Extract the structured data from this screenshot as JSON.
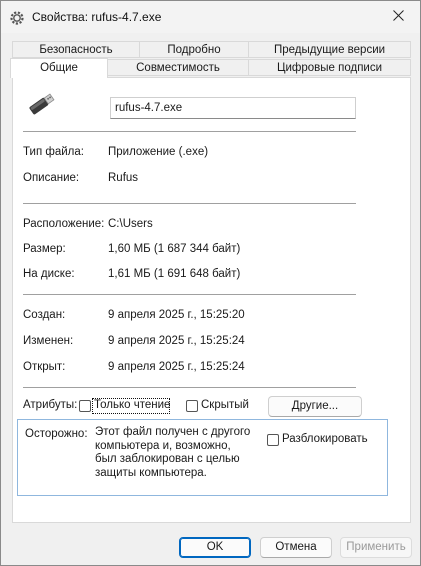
{
  "window": {
    "title": "Свойства: rufus-4.7.exe"
  },
  "tabs": {
    "row1": [
      {
        "label": "Безопасность"
      },
      {
        "label": "Подробно"
      },
      {
        "label": "Предыдущие версии"
      }
    ],
    "row2": [
      {
        "label": "Общие",
        "active": true
      },
      {
        "label": "Совместимость"
      },
      {
        "label": "Цифровые подписи"
      }
    ]
  },
  "general": {
    "file_name": "rufus-4.7.exe",
    "file_type_label": "Тип файла:",
    "file_type_value": "Приложение (.exe)",
    "description_label": "Описание:",
    "description_value": "Rufus",
    "location_label": "Расположение:",
    "location_value": "C:\\Users",
    "size_label": "Размер:",
    "size_value": "1,60 МБ (1 687 344 байт)",
    "disk_label": "На диске:",
    "disk_value": "1,61 МБ (1 691 648 байт)",
    "created_label": "Создан:",
    "created_value": "9 апреля 2025 г., 15:25:20",
    "modified_label": "Изменен:",
    "modified_value": "9 апреля 2025 г., 15:25:24",
    "accessed_label": "Открыт:",
    "accessed_value": "9 апреля 2025 г., 15:25:24",
    "attributes_label": "Атрибуты:",
    "readonly_label": "Только чтение",
    "hidden_label": "Скрытый",
    "other_button": "Другие...",
    "security_label": "Осторожно:",
    "security_text": "Этот файл получен с другого компьютера и, возможно, был заблокирован с целью защиты компьютера.",
    "unblock_label": "Разблокировать"
  },
  "buttons": {
    "ok": "OK",
    "cancel": "Отмена",
    "apply": "Применить"
  },
  "icons": {
    "app": "gear-icon",
    "file": "usb-drive-icon",
    "close": "close-icon"
  },
  "colors": {
    "focus": "#0067c0",
    "security_border": "#8fb7de"
  }
}
